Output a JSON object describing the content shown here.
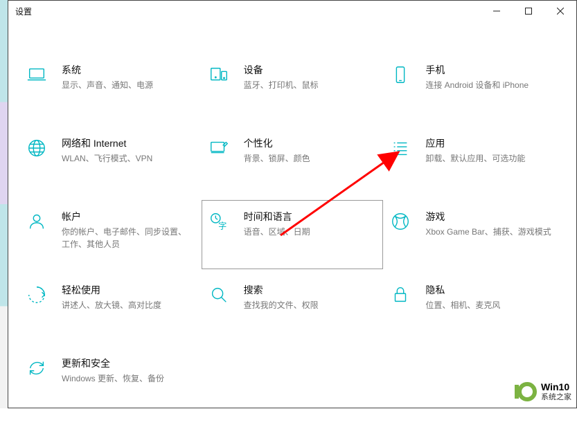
{
  "window_title": "设置",
  "tiles": [
    {
      "icon": "laptop",
      "title": "系统",
      "sub": "显示、声音、通知、电源"
    },
    {
      "icon": "devices",
      "title": "设备",
      "sub": "蓝牙、打印机、鼠标"
    },
    {
      "icon": "phone",
      "title": "手机",
      "sub": "连接 Android 设备和 iPhone"
    },
    {
      "icon": "globe",
      "title": "网络和 Internet",
      "sub": "WLAN、飞行模式、VPN"
    },
    {
      "icon": "brush",
      "title": "个性化",
      "sub": "背景、锁屏、颜色"
    },
    {
      "icon": "apps",
      "title": "应用",
      "sub": "卸载、默认应用、可选功能"
    },
    {
      "icon": "person",
      "title": "帐户",
      "sub": "你的帐户、电子邮件、同步设置、工作、其他人员"
    },
    {
      "icon": "time-lang",
      "title": "时间和语言",
      "sub": "语音、区域、日期",
      "highlight": true
    },
    {
      "icon": "gaming",
      "title": "游戏",
      "sub": "Xbox Game Bar、捕获、游戏模式"
    },
    {
      "icon": "ease",
      "title": "轻松使用",
      "sub": "讲述人、放大镜、高对比度"
    },
    {
      "icon": "search",
      "title": "搜索",
      "sub": "查找我的文件、权限"
    },
    {
      "icon": "privacy",
      "title": "隐私",
      "sub": "位置、相机、麦克风"
    },
    {
      "icon": "update",
      "title": "更新和安全",
      "sub": "Windows 更新、恢复、备份"
    }
  ],
  "watermark": {
    "title": "Win10",
    "sub": "系统之家"
  },
  "accent": "#00b7c3",
  "arrow_color": "#ff0000"
}
